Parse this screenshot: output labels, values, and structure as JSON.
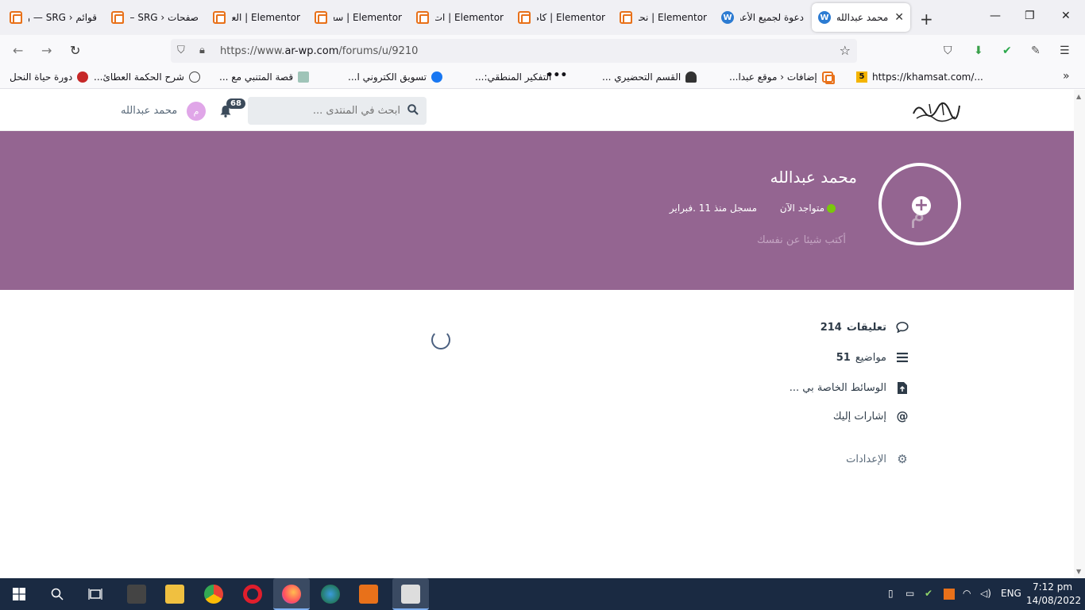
{
  "browser": {
    "tabs": [
      {
        "title": "قوائم ‹ SRG — ور",
        "icon": "elementor-icon"
      },
      {
        "title": "صفحات ‹ SRG —",
        "icon": "elementor-icon"
      },
      {
        "title": "Elementor | العة",
        "icon": "elementor-icon"
      },
      {
        "title": "Elementor | سعار",
        "icon": "elementor-icon"
      },
      {
        "title": "Elementor | ات",
        "icon": "elementor-icon"
      },
      {
        "title": "Elementor | كام",
        "icon": "elementor-icon"
      },
      {
        "title": "Elementor | نحن",
        "icon": "elementor-icon"
      },
      {
        "title": "دعوة لجميع الأعضا",
        "icon": "wordpress-icon"
      },
      {
        "title": "محمد عبدالله",
        "icon": "wordpress-icon",
        "active": true
      }
    ],
    "url_prefix": "https://www.",
    "url_domain": "ar-wp.com",
    "url_path": "/forums/u/9210",
    "bookmarks": [
      {
        "label": "دورة حياة النحل"
      },
      {
        "label": "شرح الحكمة العطائ..."
      },
      {
        "label": "قصة المتنبي مع ..."
      },
      {
        "label": "تسويق الكتروني ا..."
      },
      {
        "label": "التفكير المنطقي:..."
      },
      {
        "label": "القسم التحضيري ..."
      },
      {
        "label": "إضافات ‹ موقع عبدا..."
      },
      {
        "label": "https://khamsat.com/..."
      }
    ]
  },
  "site": {
    "search_placeholder": "ابحث في المنتدى ...",
    "notifications_count": "68",
    "user_initial": "م",
    "user_name": "محمد عبدالله"
  },
  "profile": {
    "name": "محمد عبدالله",
    "status": "متواجد الآن",
    "joined": "مسجل منذ 11 .فبراير",
    "bio_placeholder": "أكتب شيئا عن نفسك",
    "avatar_initial": "م",
    "colors": {
      "banner": "#946591",
      "online": "#7ac70c"
    }
  },
  "menu": {
    "comments_label": "تعليقات",
    "comments_count": "214",
    "topics_label": "مواضيع",
    "topics_count": "51",
    "media_label": "الوسائط الخاصة بي ...",
    "mentions_label": "إشارات إليك",
    "settings_label": "الإعدادات"
  },
  "taskbar": {
    "language": "ENG",
    "time": "7:12 pm",
    "date": "14/08/2022"
  }
}
